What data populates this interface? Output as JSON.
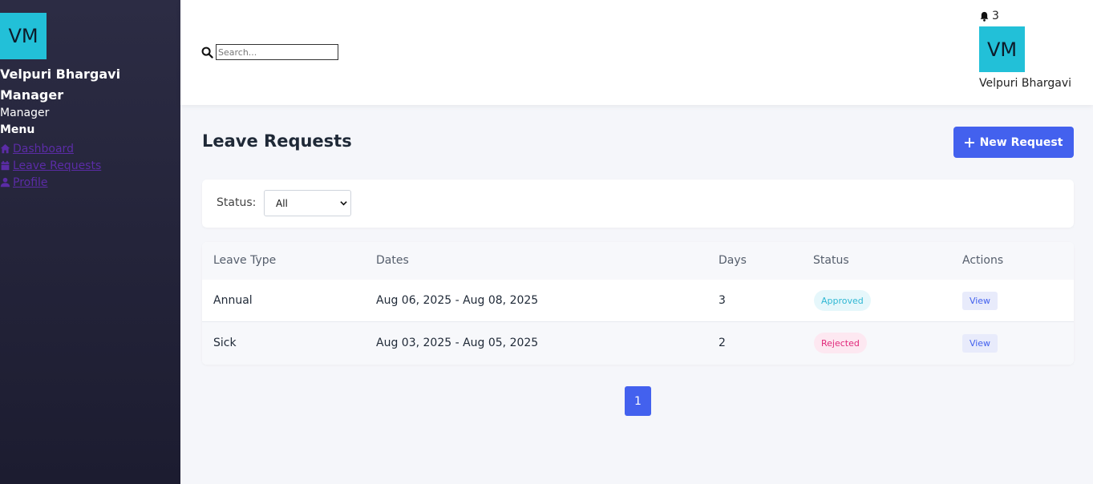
{
  "sidebar": {
    "avatar_initials": "VM",
    "user_name": "Velpuri Bhargavi Manager",
    "role": "Manager",
    "menu_title": "Menu",
    "items": [
      {
        "label": "Dashboard",
        "icon": "home-icon"
      },
      {
        "label": "Leave Requests",
        "icon": "calendar-icon"
      },
      {
        "label": "Profile",
        "icon": "user-icon"
      }
    ]
  },
  "topbar": {
    "search_placeholder": "Search...",
    "notification_count": "3",
    "avatar_initials": "VM",
    "user_name": "Velpuri Bhargavi"
  },
  "main": {
    "title": "Leave Requests",
    "new_request_label": "New Request",
    "filter": {
      "label": "Status:",
      "selected": "All"
    },
    "table": {
      "columns": [
        "Leave Type",
        "Dates",
        "Days",
        "Status",
        "Actions"
      ],
      "rows": [
        {
          "type": "Annual",
          "dates": "Aug 06, 2025 - Aug 08, 2025",
          "days": "3",
          "status": "Approved",
          "action": "View"
        },
        {
          "type": "Sick",
          "dates": "Aug 03, 2025 - Aug 05, 2025",
          "days": "2",
          "status": "Rejected",
          "action": "View"
        }
      ]
    },
    "pagination": {
      "current_page": "1"
    }
  },
  "colors": {
    "accent": "#4361ee",
    "avatar_bg": "#22c0d8",
    "sidebar_bg": "#24243a",
    "approved": "#2fb7d3",
    "rejected": "#e0287a"
  }
}
